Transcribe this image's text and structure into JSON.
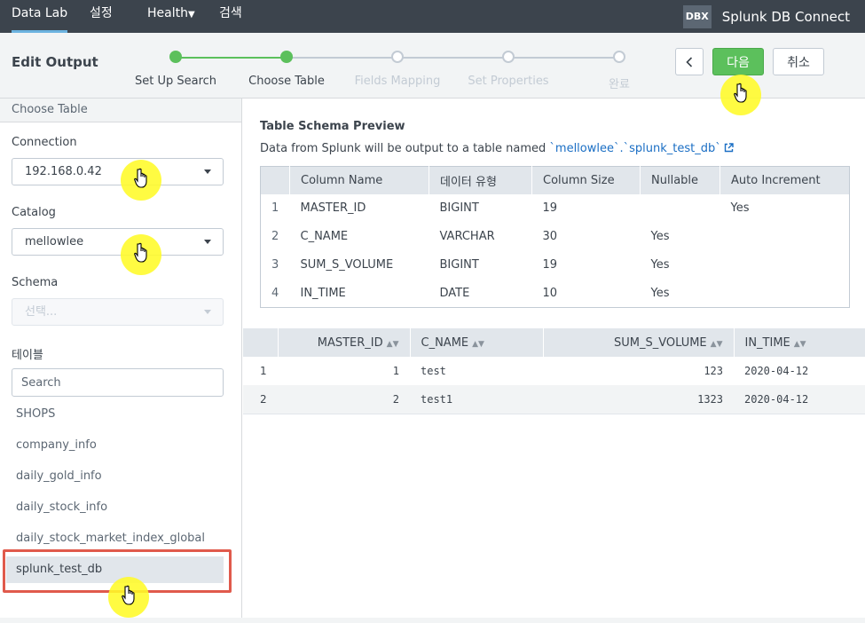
{
  "nav": {
    "items": [
      "Data Lab",
      "설정",
      "Health",
      "검색"
    ],
    "brand_badge": "DBX",
    "brand_name": "Splunk DB Connect"
  },
  "header": {
    "title": "Edit Output",
    "steps": [
      {
        "label": "Set Up Search",
        "state": "done"
      },
      {
        "label": "Choose Table",
        "state": "done"
      },
      {
        "label": "Fields Mapping",
        "state": "todo"
      },
      {
        "label": "Set Properties",
        "state": "todo"
      },
      {
        "label": "완료",
        "state": "todo"
      }
    ],
    "back_icon": "chevron-left-icon",
    "next_label": "다음",
    "cancel_label": "취소"
  },
  "sidebar": {
    "heading": "Choose Table",
    "connection_label": "Connection",
    "connection_value": "192.168.0.42",
    "catalog_label": "Catalog",
    "catalog_value": "mellowlee",
    "schema_label": "Schema",
    "schema_placeholder": "선택...",
    "tables_label": "테이블",
    "search_placeholder": "Search",
    "tables": [
      "SHOPS",
      "company_info",
      "daily_gold_info",
      "daily_stock_info",
      "daily_stock_market_index_global",
      "splunk_test_db"
    ],
    "selected_table": "splunk_test_db"
  },
  "schema_preview": {
    "title": "Table Schema Preview",
    "desc_prefix": "Data from Splunk will be output to a table named ",
    "table_ref": "`mellowlee`.`splunk_test_db`",
    "columns": [
      "Column Name",
      "데이터 유형",
      "Column Size",
      "Nullable",
      "Auto Increment"
    ],
    "rows": [
      {
        "idx": "1",
        "name": "MASTER_ID",
        "type": "BIGINT",
        "size": "19",
        "nullable": "",
        "auto": "Yes"
      },
      {
        "idx": "2",
        "name": "C_NAME",
        "type": "VARCHAR",
        "size": "30",
        "nullable": "Yes",
        "auto": ""
      },
      {
        "idx": "3",
        "name": "SUM_S_VOLUME",
        "type": "BIGINT",
        "size": "19",
        "nullable": "Yes",
        "auto": ""
      },
      {
        "idx": "4",
        "name": "IN_TIME",
        "type": "DATE",
        "size": "10",
        "nullable": "Yes",
        "auto": ""
      }
    ]
  },
  "data_preview": {
    "columns": [
      "MASTER_ID",
      "C_NAME",
      "SUM_S_VOLUME",
      "IN_TIME"
    ],
    "rows": [
      {
        "idx": "1",
        "master_id": "1",
        "c_name": "test",
        "sum_s_volume": "123",
        "in_time": "2020-04-12"
      },
      {
        "idx": "2",
        "master_id": "2",
        "c_name": "test1",
        "sum_s_volume": "1323",
        "in_time": "2020-04-12"
      }
    ]
  },
  "colors": {
    "nav_bg": "#3c444d",
    "accent_green": "#5cc05c",
    "highlight_red": "#e05a4c",
    "link_blue": "#1a6ec4",
    "cursor_yellow": "#fffa28"
  }
}
